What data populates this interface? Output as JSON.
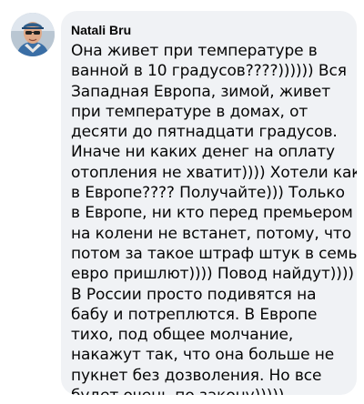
{
  "comment": {
    "author": "Natali Bru",
    "lines": [
      "Она живет при температуре в",
      "ванной в 10 градусов????)))))) Вся",
      "Западная Европа, зимой, живет",
      "при температуре в домах, от",
      "десяти до пятнадцати градусов.",
      "Иначе ни каких денег на оплату",
      "отопления не хватит)))) Хотели как",
      "в Европе???? Получайте))) Только",
      "в Европе, ни кто перед премьером",
      "на колени не встанет, потому, что",
      "потом за такое штраф штук в семь",
      "евро пришлют)))) Повод найдут))))",
      "В России просто подивятся на",
      "бабу и потреплются. В Европе",
      "тихо, под общее молчание,",
      "накажут так, что она больше не",
      "пукнет без дозволения. Но все",
      "будет очень по закону)))))"
    ]
  },
  "colors": {
    "bubble_bg": "#f0f2f5",
    "text": "#050505",
    "page_bg": "#ffffff"
  },
  "icons": {
    "avatar": "user-photo-avatar"
  }
}
